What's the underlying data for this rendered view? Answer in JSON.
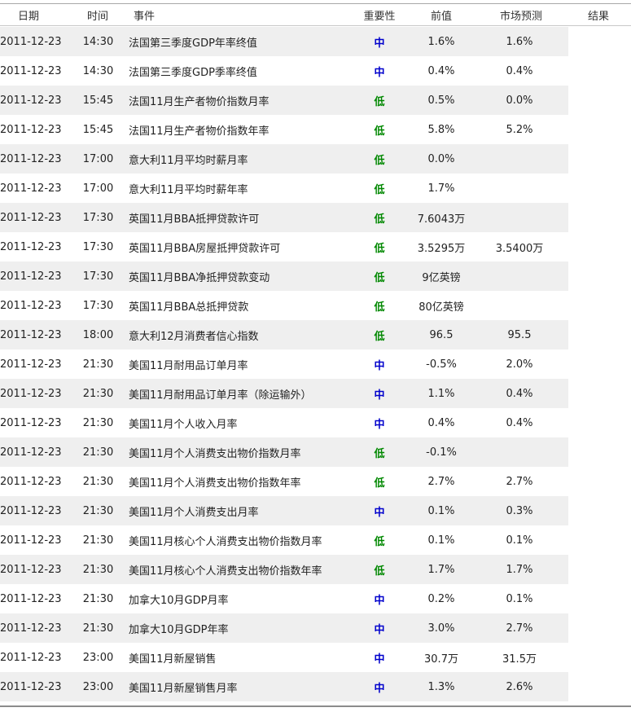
{
  "table": {
    "headers": {
      "date": "日期",
      "time": "时间",
      "event": "事件",
      "importance": "重要性",
      "previous": "前值",
      "forecast": "市场预测",
      "actual": "结果"
    },
    "colors": {
      "mid": "#0000cc",
      "low": "#008800",
      "band": "#efefef"
    },
    "rows": [
      {
        "date": "2011-12-23",
        "time": "14:30",
        "event": "法国第三季度GDP年率终值",
        "importance": "中",
        "level": "mid",
        "previous": "1.6%",
        "forecast": "1.6%",
        "actual": ""
      },
      {
        "date": "2011-12-23",
        "time": "14:30",
        "event": "法国第三季度GDP季率终值",
        "importance": "中",
        "level": "mid",
        "previous": "0.4%",
        "forecast": "0.4%",
        "actual": ""
      },
      {
        "date": "2011-12-23",
        "time": "15:45",
        "event": "法国11月生产者物价指数月率",
        "importance": "低",
        "level": "low",
        "previous": "0.5%",
        "forecast": "0.0%",
        "actual": ""
      },
      {
        "date": "2011-12-23",
        "time": "15:45",
        "event": "法国11月生产者物价指数年率",
        "importance": "低",
        "level": "low",
        "previous": "5.8%",
        "forecast": "5.2%",
        "actual": ""
      },
      {
        "date": "2011-12-23",
        "time": "17:00",
        "event": "意大利11月平均时薪月率",
        "importance": "低",
        "level": "low",
        "previous": "0.0%",
        "forecast": "",
        "actual": ""
      },
      {
        "date": "2011-12-23",
        "time": "17:00",
        "event": "意大利11月平均时薪年率",
        "importance": "低",
        "level": "low",
        "previous": "1.7%",
        "forecast": "",
        "actual": ""
      },
      {
        "date": "2011-12-23",
        "time": "17:30",
        "event": "英国11月BBA抵押贷款许可",
        "importance": "低",
        "level": "low",
        "previous": "7.6043万",
        "forecast": "",
        "actual": ""
      },
      {
        "date": "2011-12-23",
        "time": "17:30",
        "event": "英国11月BBA房屋抵押贷款许可",
        "importance": "低",
        "level": "low",
        "previous": "3.5295万",
        "forecast": "3.5400万",
        "actual": ""
      },
      {
        "date": "2011-12-23",
        "time": "17:30",
        "event": "英国11月BBA净抵押贷款变动",
        "importance": "低",
        "level": "low",
        "previous": "9亿英镑",
        "forecast": "",
        "actual": ""
      },
      {
        "date": "2011-12-23",
        "time": "17:30",
        "event": "英国11月BBA总抵押贷款",
        "importance": "低",
        "level": "low",
        "previous": "80亿英镑",
        "forecast": "",
        "actual": ""
      },
      {
        "date": "2011-12-23",
        "time": "18:00",
        "event": "意大利12月消费者信心指数",
        "importance": "低",
        "level": "low",
        "previous": "96.5",
        "forecast": "95.5",
        "actual": ""
      },
      {
        "date": "2011-12-23",
        "time": "21:30",
        "event": "美国11月耐用品订单月率",
        "importance": "中",
        "level": "mid",
        "previous": "-0.5%",
        "forecast": "2.0%",
        "actual": ""
      },
      {
        "date": "2011-12-23",
        "time": "21:30",
        "event": "美国11月耐用品订单月率（除运输外）",
        "importance": "中",
        "level": "mid",
        "previous": "1.1%",
        "forecast": "0.4%",
        "actual": ""
      },
      {
        "date": "2011-12-23",
        "time": "21:30",
        "event": "美国11月个人收入月率",
        "importance": "中",
        "level": "mid",
        "previous": "0.4%",
        "forecast": "0.4%",
        "actual": ""
      },
      {
        "date": "2011-12-23",
        "time": "21:30",
        "event": "美国11月个人消费支出物价指数月率",
        "importance": "低",
        "level": "low",
        "previous": "-0.1%",
        "forecast": "",
        "actual": ""
      },
      {
        "date": "2011-12-23",
        "time": "21:30",
        "event": "美国11月个人消费支出物价指数年率",
        "importance": "低",
        "level": "low",
        "previous": "2.7%",
        "forecast": "2.7%",
        "actual": ""
      },
      {
        "date": "2011-12-23",
        "time": "21:30",
        "event": "美国11月个人消费支出月率",
        "importance": "中",
        "level": "mid",
        "previous": "0.1%",
        "forecast": "0.3%",
        "actual": ""
      },
      {
        "date": "2011-12-23",
        "time": "21:30",
        "event": "美国11月核心个人消费支出物价指数月率",
        "importance": "低",
        "level": "low",
        "previous": "0.1%",
        "forecast": "0.1%",
        "actual": ""
      },
      {
        "date": "2011-12-23",
        "time": "21:30",
        "event": "美国11月核心个人消费支出物价指数年率",
        "importance": "低",
        "level": "low",
        "previous": "1.7%",
        "forecast": "1.7%",
        "actual": ""
      },
      {
        "date": "2011-12-23",
        "time": "21:30",
        "event": "加拿大10月GDP月率",
        "importance": "中",
        "level": "mid",
        "previous": "0.2%",
        "forecast": "0.1%",
        "actual": ""
      },
      {
        "date": "2011-12-23",
        "time": "21:30",
        "event": "加拿大10月GDP年率",
        "importance": "中",
        "level": "mid",
        "previous": "3.0%",
        "forecast": "2.7%",
        "actual": ""
      },
      {
        "date": "2011-12-23",
        "time": "23:00",
        "event": "美国11月新屋销售",
        "importance": "中",
        "level": "mid",
        "previous": "30.7万",
        "forecast": "31.5万",
        "actual": ""
      },
      {
        "date": "2011-12-23",
        "time": "23:00",
        "event": "美国11月新屋销售月率",
        "importance": "中",
        "level": "mid",
        "previous": "1.3%",
        "forecast": "2.6%",
        "actual": ""
      }
    ]
  }
}
